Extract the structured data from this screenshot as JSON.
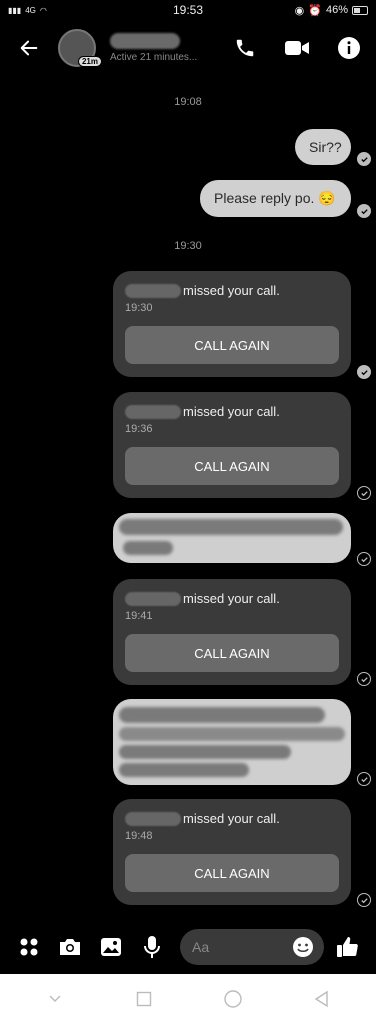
{
  "status_bar": {
    "time": "19:53",
    "battery": "46%",
    "signal_text": "4G"
  },
  "header": {
    "contact_status": "Active 21 minutes...",
    "avatar_badge": "21m"
  },
  "messages": {
    "ts1": "19:08",
    "ts2": "19:30",
    "out1": "Sir??",
    "out2": "Please reply po. 😔"
  },
  "calls": [
    {
      "text": "missed your call.",
      "time": "19:30",
      "button": "CALL AGAIN"
    },
    {
      "text": "missed your call.",
      "time": "19:36",
      "button": "CALL AGAIN"
    },
    {
      "text": "missed your call.",
      "time": "19:41",
      "button": "CALL AGAIN"
    },
    {
      "text": "missed your call.",
      "time": "19:48",
      "button": "CALL AGAIN"
    }
  ],
  "composer": {
    "placeholder": "Aa"
  },
  "icons": {
    "back": "back-arrow-icon",
    "phone": "phone-icon",
    "video": "video-icon",
    "info": "info-icon",
    "menu": "grid-dots-icon",
    "camera": "camera-icon",
    "gallery": "image-icon",
    "mic": "microphone-icon",
    "emoji": "emoji-icon",
    "like": "thumbs-up-icon"
  },
  "colors": {
    "background": "#000000",
    "bubble_out": "#d0d0d0",
    "card": "#3a3a3a",
    "button": "#6a6a6a"
  }
}
